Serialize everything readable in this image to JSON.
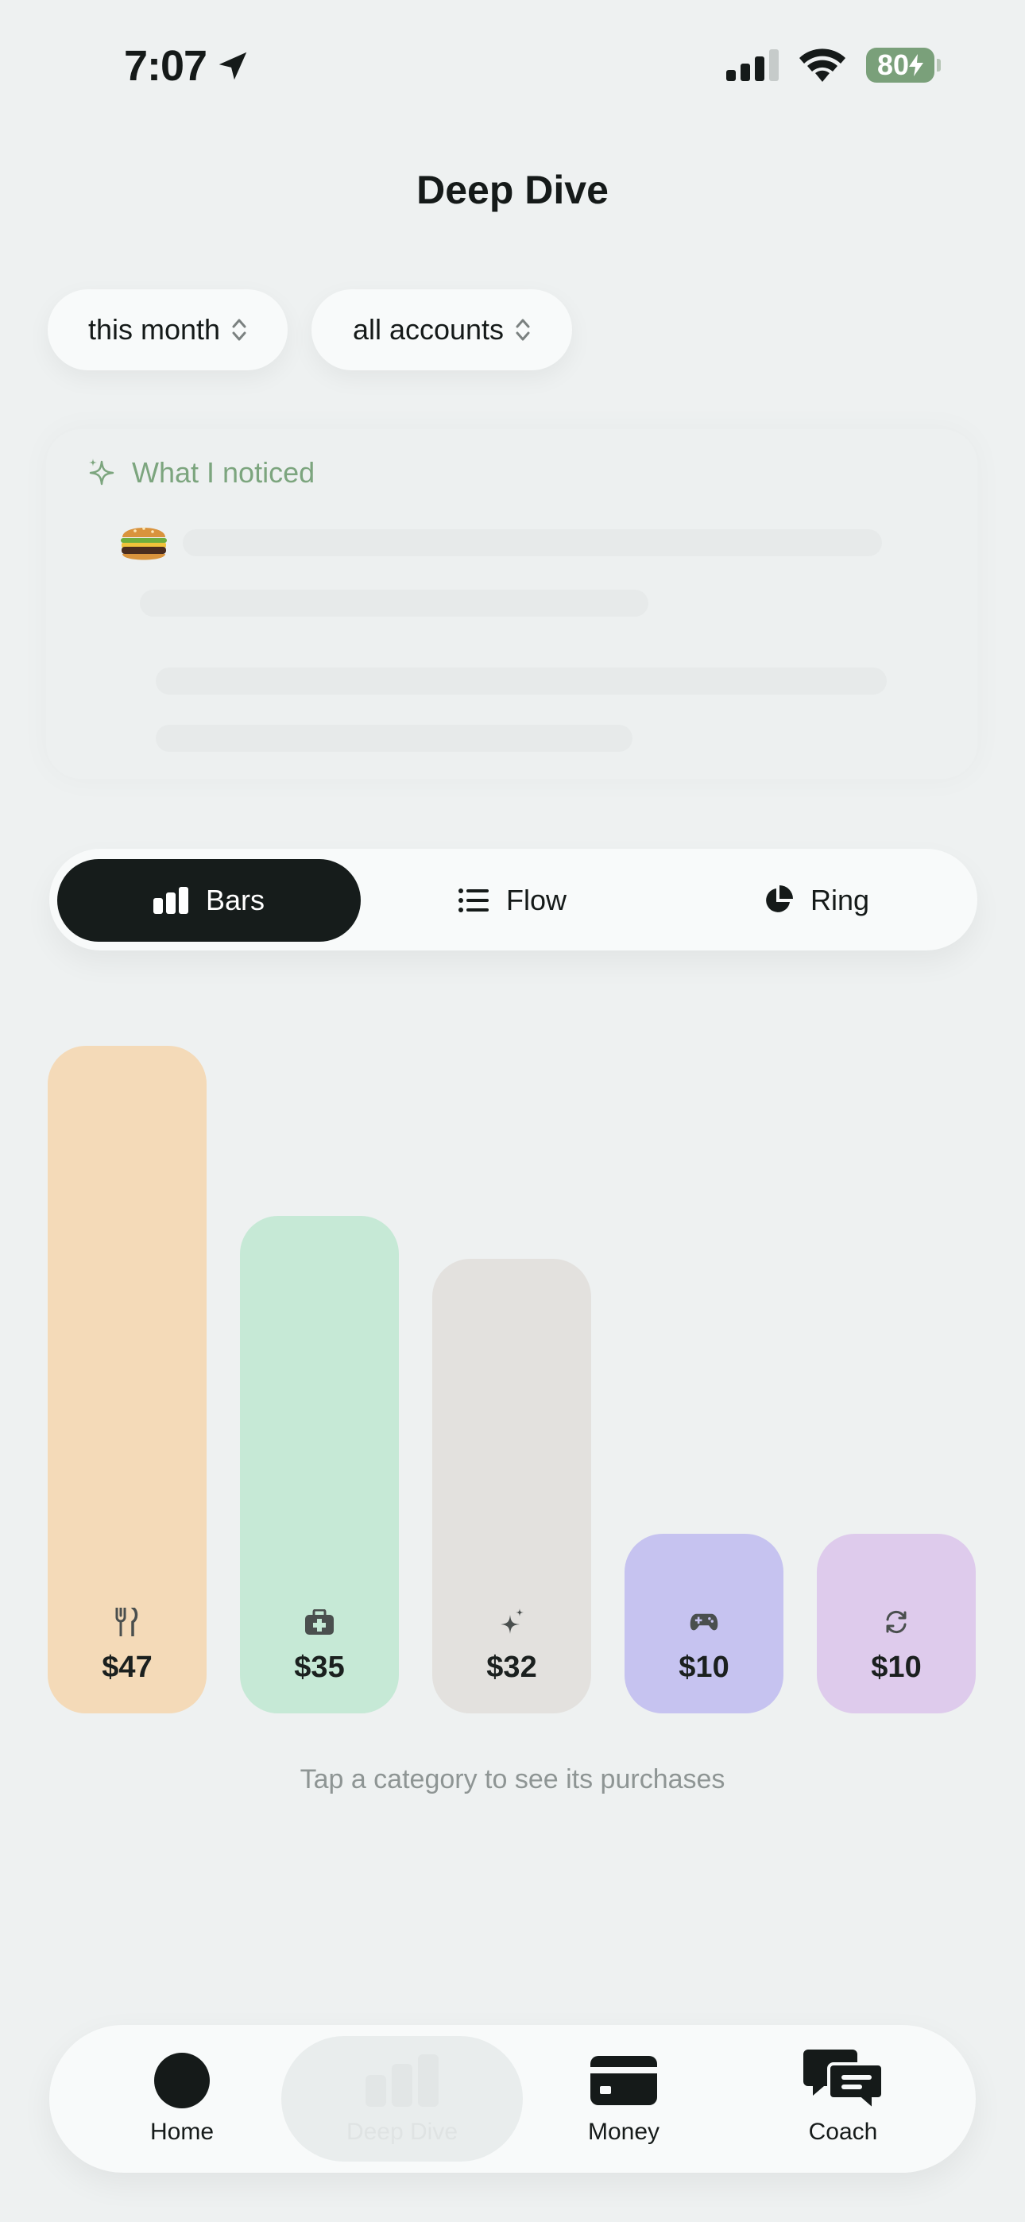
{
  "status_bar": {
    "time": "7:07",
    "battery": "80"
  },
  "header": {
    "title": "Deep Dive"
  },
  "filters": {
    "period": "this month",
    "accounts": "all accounts"
  },
  "insight": {
    "heading": "What I noticed"
  },
  "view_toggle": {
    "options": [
      "Bars",
      "Flow",
      "Ring"
    ],
    "selected": "Bars"
  },
  "chart_data": {
    "type": "bar",
    "categories": [
      "food",
      "health",
      "other",
      "games",
      "subscriptions"
    ],
    "values": [
      47,
      35,
      32,
      10,
      10
    ],
    "labels": [
      "$47",
      "$35",
      "$32",
      "$10",
      "$10"
    ],
    "colors": [
      "#f4dab8",
      "#c6e9d6",
      "#e3e1de",
      "#c6c3f0",
      "#decbec"
    ],
    "icons": [
      "fork-knife-icon",
      "first-aid-kit-icon",
      "sparkle-icon",
      "gamepad-icon",
      "refresh-icon"
    ]
  },
  "hint": "Tap a category to see its purchases",
  "bottom_nav": {
    "items": [
      "Home",
      "Deep Dive",
      "Money",
      "Coach"
    ],
    "selected": "Deep Dive"
  }
}
